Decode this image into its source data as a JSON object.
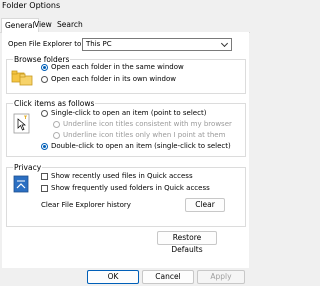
{
  "window": {
    "title": "Folder Options"
  },
  "tabs": [
    {
      "label": "General"
    },
    {
      "label": "View"
    },
    {
      "label": "Search"
    }
  ],
  "general": {
    "open_explorer_label": "Open File Explorer to:",
    "open_explorer_value": "This PC",
    "browse": {
      "title": "Browse folders",
      "options": [
        "Open each folder in the same window",
        "Open each folder in its own window"
      ],
      "selected": 0
    },
    "click": {
      "title": "Click items as follows",
      "single": "Single-click to open an item (point to select)",
      "underline_consistent": "Underline icon titles consistent with my browser",
      "underline_point": "Underline icon titles only when I point at them",
      "double": "Double-click to open an item (single-click to select)",
      "selected": "double"
    },
    "privacy": {
      "title": "Privacy",
      "recent_files": "Show recently used files in Quick access",
      "frequent_folders": "Show frequently used folders in Quick access",
      "clear_history": "Clear File Explorer history",
      "clear_button": "Clear"
    },
    "restore_button": "Restore Defaults"
  },
  "footer": {
    "ok": "OK",
    "cancel": "Cancel",
    "apply": "Apply"
  },
  "colors": {
    "accent": "#005fb8",
    "panel": "#ffffff",
    "chrome": "#f0f0f0"
  }
}
